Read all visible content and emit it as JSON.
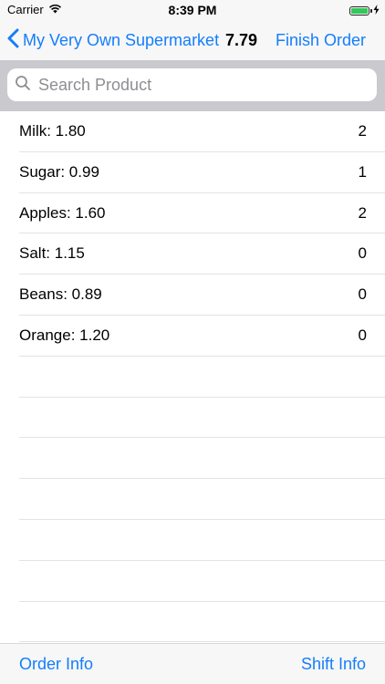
{
  "status_bar": {
    "carrier": "Carrier",
    "time": "8:39 PM",
    "battery_level": 1.0
  },
  "nav_bar": {
    "back_label": "My Very Own Supermarket",
    "total": "7.79",
    "finish_label": "Finish Order"
  },
  "search": {
    "placeholder": "Search Product",
    "value": ""
  },
  "products": [
    {
      "label": "Milk: 1.80",
      "qty": "2"
    },
    {
      "label": "Sugar: 0.99",
      "qty": "1"
    },
    {
      "label": "Apples: 1.60",
      "qty": "2"
    },
    {
      "label": "Salt: 1.15",
      "qty": "0"
    },
    {
      "label": "Beans: 0.89",
      "qty": "0"
    },
    {
      "label": "Orange: 1.20",
      "qty": "0"
    }
  ],
  "toolbar": {
    "order_info_label": "Order Info",
    "shift_info_label": "Shift Info"
  },
  "colors": {
    "accent": "#147efb",
    "battery": "#34c759",
    "search_background": "#c9c9ce"
  },
  "icons": {
    "back": "chevron-left-icon",
    "search": "search-icon",
    "wifi": "wifi-icon",
    "battery": "battery-icon",
    "charging": "bolt-icon"
  }
}
